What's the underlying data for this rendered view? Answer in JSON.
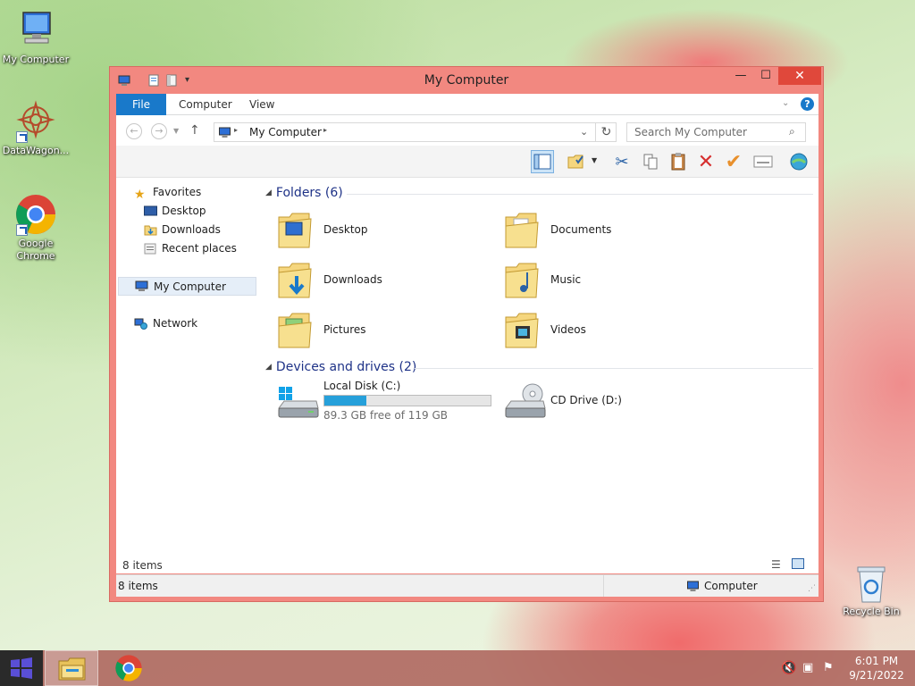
{
  "desktop": {
    "icons": [
      {
        "label": "My Computer"
      },
      {
        "label": "DataWagon..."
      },
      {
        "label": "Google Chrome"
      }
    ],
    "recycle_bin": "Recycle Bin"
  },
  "window": {
    "title": "My Computer",
    "ribbon_tabs": [
      "File",
      "Computer",
      "View"
    ],
    "address": {
      "path": "My Computer"
    },
    "search": {
      "placeholder": "Search My Computer"
    },
    "nav": {
      "favorites": "Favorites",
      "favorites_items": [
        "Desktop",
        "Downloads",
        "Recent places"
      ],
      "computer": "My Computer",
      "network": "Network"
    },
    "groups": {
      "folders": {
        "title": "Folders (6)",
        "items": [
          "Desktop",
          "Documents",
          "Downloads",
          "Music",
          "Pictures",
          "Videos"
        ]
      },
      "drives": {
        "title": "Devices and drives (2)",
        "local": {
          "name": "Local Disk (C:)",
          "free": "89.3 GB free of 119 GB",
          "used_fraction": 0.25
        },
        "cd": {
          "name": "CD Drive (D:)"
        }
      }
    },
    "status_inner": "8 items",
    "status_left": "8 items",
    "status_right": "Computer"
  },
  "taskbar": {
    "time": "6:01 PM",
    "date": "9/21/2022"
  },
  "colors": {
    "accent": "#1979ca",
    "window_frame": "#f28880",
    "close": "#e0483b",
    "drive_bar": "#26a0da"
  }
}
